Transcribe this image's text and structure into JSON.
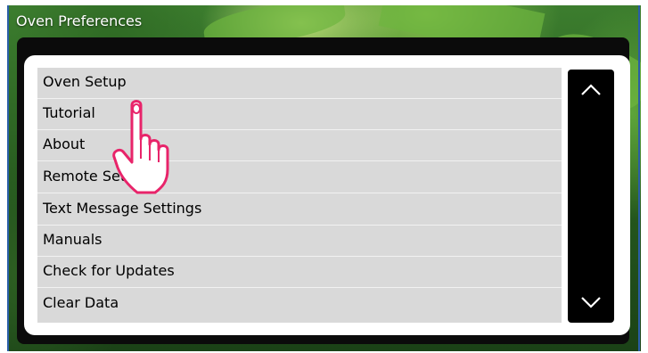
{
  "window": {
    "title": "Oven Preferences"
  },
  "menu": {
    "items": [
      "Oven Setup",
      "Tutorial",
      "About",
      "Remote Settings",
      "Text Message Settings",
      "Manuals",
      "Check for Updates",
      "Clear Data"
    ]
  },
  "scrollbar": {
    "up_icon": "chevron-up-icon",
    "down_icon": "chevron-down-icon"
  },
  "cursor": {
    "icon": "pointing-hand-cursor-icon",
    "color": "#e8246a"
  }
}
